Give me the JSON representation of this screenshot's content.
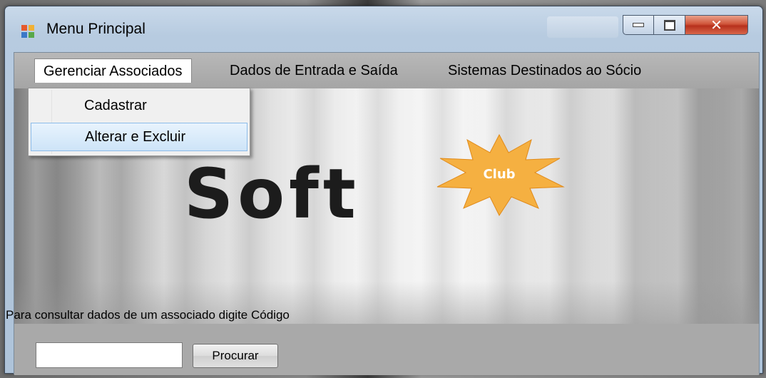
{
  "window": {
    "title": "Menu Principal"
  },
  "menu": {
    "items": [
      {
        "label": "Gerenciar Associados"
      },
      {
        "label": "Dados de Entrada e Saída"
      },
      {
        "label": "Sistemas Destinados ao Sócio"
      }
    ],
    "dropdown": [
      {
        "label": "Cadastrar"
      },
      {
        "label": "Alterar e Excluir"
      }
    ]
  },
  "logo": {
    "word": "Soft",
    "badge": "Club",
    "badge_color": "#f5b041"
  },
  "search": {
    "prompt": "Para consultar dados de um associado digite  Código",
    "value": "",
    "button_label": "Procurar"
  },
  "colors": {
    "close_button": "#c8442b",
    "menu_hover": "#cde4f8"
  }
}
